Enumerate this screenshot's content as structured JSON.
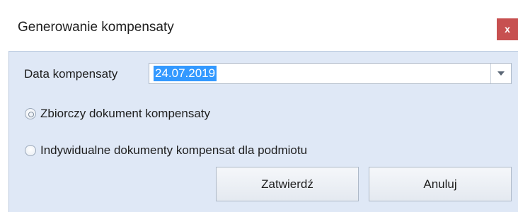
{
  "window": {
    "title": "Generowanie kompensaty",
    "close_label": "x"
  },
  "form": {
    "date_label": "Data kompensaty",
    "date_value": "24.07.2019",
    "options": [
      {
        "label": "Zbiorczy dokument kompensaty",
        "selected": false
      },
      {
        "label": "Indywidualne dokumenty kompensat dla podmiotu",
        "selected": false
      }
    ]
  },
  "buttons": {
    "confirm": "Zatwierdź",
    "cancel": "Anuluj"
  },
  "colors": {
    "client_background": "#dfe8f6",
    "close_button": "#c75050",
    "selection": "#3399ff"
  },
  "icons": {
    "close": "close-icon",
    "combo_arrow": "chevron-down-icon",
    "radio": "radio-icon"
  }
}
